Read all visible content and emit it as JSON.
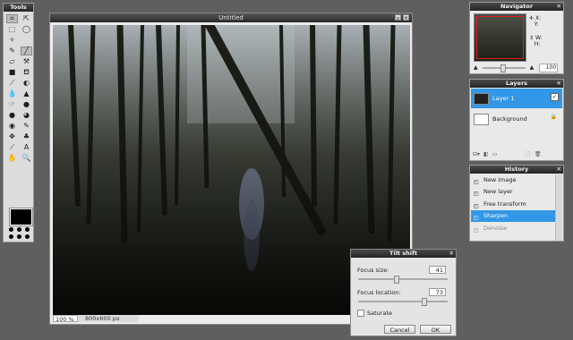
{
  "tools": {
    "title": "Tools",
    "items": [
      {
        "name": "crop-icon",
        "glyph": "⌗",
        "selected": true
      },
      {
        "name": "move-icon",
        "glyph": "⇱",
        "selected": false
      },
      {
        "name": "marquee-icon",
        "glyph": "⬚",
        "selected": false
      },
      {
        "name": "lasso-icon",
        "glyph": "◯",
        "selected": false
      },
      {
        "name": "wand-icon",
        "glyph": "✧",
        "selected": false
      },
      {
        "name": "blank-icon",
        "glyph": "",
        "selected": false
      },
      {
        "name": "pencil-icon",
        "glyph": "✎",
        "selected": false
      },
      {
        "name": "brush-icon",
        "glyph": "╱",
        "selected": true
      },
      {
        "name": "eraser-icon",
        "glyph": "▱",
        "selected": false
      },
      {
        "name": "replace-icon",
        "glyph": "⚒",
        "selected": false
      },
      {
        "name": "gradient-icon",
        "glyph": "■",
        "selected": false
      },
      {
        "name": "bucket-icon",
        "glyph": "⛾",
        "selected": false
      },
      {
        "name": "picker-icon",
        "glyph": "⟋",
        "selected": false
      },
      {
        "name": "clone-icon",
        "glyph": "◐",
        "selected": false
      },
      {
        "name": "drop-icon",
        "glyph": "💧",
        "selected": false
      },
      {
        "name": "sharpen-icon",
        "glyph": "▲",
        "selected": false
      },
      {
        "name": "smudge-icon",
        "glyph": "☞",
        "selected": false
      },
      {
        "name": "sponge-icon",
        "glyph": "●",
        "selected": false
      },
      {
        "name": "dodge-icon",
        "glyph": "●",
        "selected": false
      },
      {
        "name": "burn-icon",
        "glyph": "◕",
        "selected": false
      },
      {
        "name": "redeye-icon",
        "glyph": "◉",
        "selected": false
      },
      {
        "name": "spot-icon",
        "glyph": "✎",
        "selected": false
      },
      {
        "name": "pan-icon",
        "glyph": "✥",
        "selected": false
      },
      {
        "name": "stamp-icon",
        "glyph": "♣",
        "selected": false
      },
      {
        "name": "colorpick-icon",
        "glyph": "⟋",
        "selected": false
      },
      {
        "name": "type-icon",
        "glyph": "A",
        "selected": false
      },
      {
        "name": "hand-icon",
        "glyph": "✋",
        "selected": false
      },
      {
        "name": "zoom-icon",
        "glyph": "🔍",
        "selected": false
      }
    ]
  },
  "document": {
    "title": "Untitled",
    "zoom": "100",
    "zoom_unit": "%",
    "size": "800x600 px"
  },
  "navigator": {
    "title": "Navigator",
    "x_label": "X:",
    "y_label": "Y:",
    "w_label": "W:",
    "h_label": "H:",
    "zoom_value": "100"
  },
  "layers": {
    "title": "Layers",
    "items": [
      {
        "label": "Layer 1",
        "active": true
      },
      {
        "label": "Background",
        "active": false
      }
    ]
  },
  "history": {
    "title": "History",
    "items": [
      {
        "label": "New image",
        "state": "normal"
      },
      {
        "label": "New layer",
        "state": "normal"
      },
      {
        "label": "Free transform",
        "state": "normal"
      },
      {
        "label": "Sharpen",
        "state": "active"
      },
      {
        "label": "Denoise",
        "state": "dim"
      }
    ]
  },
  "tilt_shift": {
    "title": "Tilt shift",
    "focus_size_label": "Focus size:",
    "focus_size_value": "41",
    "focus_location_label": "Focus location:",
    "focus_location_value": "73",
    "saturate_label": "Saturate",
    "cancel_label": "Cancel",
    "ok_label": "OK"
  }
}
